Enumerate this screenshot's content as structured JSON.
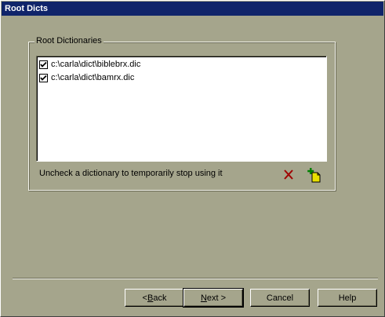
{
  "window": {
    "title": "Root Dicts"
  },
  "group": {
    "label": "Root Dictionaries"
  },
  "dictionaries": [
    {
      "path": "c:\\carla\\dict\\biblebrx.dic",
      "checked": true
    },
    {
      "path": "c:\\carla\\dict\\bamrx.dic",
      "checked": true
    }
  ],
  "hint": "Uncheck a dictionary to temporarily stop using it",
  "icons": {
    "delete": "delete-x-icon",
    "add": "add-file-icon"
  },
  "buttons": {
    "back_prefix": "< ",
    "back_mnemonic": "B",
    "back_rest": "ack",
    "next_mnemonic": "N",
    "next_rest": "ext >",
    "cancel": "Cancel",
    "help": "Help"
  },
  "colors": {
    "face": "#a5a58c",
    "title": "#10246a",
    "delete": "#a00000",
    "add": "#e8e000"
  }
}
